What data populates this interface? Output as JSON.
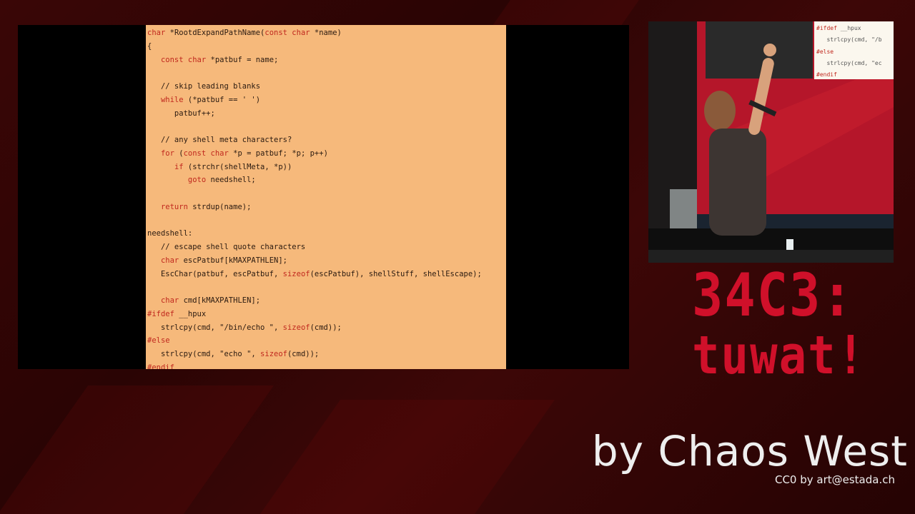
{
  "slide": {
    "code_lines": [
      [
        {
          "t": "char",
          "k": 1
        },
        {
          "t": " *RootdExpandPathName("
        },
        {
          "t": "const char",
          "k": 1
        },
        {
          "t": " *name)"
        }
      ],
      [
        {
          "t": "{"
        }
      ],
      [
        {
          "t": "   "
        },
        {
          "t": "const char",
          "k": 1
        },
        {
          "t": " *patbuf = name;"
        }
      ],
      [
        {
          "t": ""
        }
      ],
      [
        {
          "t": "   // skip leading blanks"
        }
      ],
      [
        {
          "t": "   "
        },
        {
          "t": "while",
          "k": 1
        },
        {
          "t": " (*patbuf == ' ')"
        }
      ],
      [
        {
          "t": "      patbuf++;"
        }
      ],
      [
        {
          "t": ""
        }
      ],
      [
        {
          "t": "   // any shell meta characters?"
        }
      ],
      [
        {
          "t": "   "
        },
        {
          "t": "for",
          "k": 1
        },
        {
          "t": " ("
        },
        {
          "t": "const char",
          "k": 1
        },
        {
          "t": " *p = patbuf; *p; p++)"
        }
      ],
      [
        {
          "t": "      "
        },
        {
          "t": "if",
          "k": 1
        },
        {
          "t": " (strchr(shellMeta, *p))"
        }
      ],
      [
        {
          "t": "         "
        },
        {
          "t": "goto",
          "k": 1
        },
        {
          "t": " needshell;"
        }
      ],
      [
        {
          "t": ""
        }
      ],
      [
        {
          "t": "   "
        },
        {
          "t": "return",
          "k": 1
        },
        {
          "t": " strdup(name);"
        }
      ],
      [
        {
          "t": ""
        }
      ],
      [
        {
          "t": "needshell:"
        }
      ],
      [
        {
          "t": "   // escape shell quote characters"
        }
      ],
      [
        {
          "t": "   "
        },
        {
          "t": "char",
          "k": 1
        },
        {
          "t": " escPatbuf[kMAXPATHLEN];"
        }
      ],
      [
        {
          "t": "   EscChar(patbuf, escPatbuf, "
        },
        {
          "t": "sizeof",
          "k": 1
        },
        {
          "t": "(escPatbuf), shellStuff, shellEscape);"
        }
      ],
      [
        {
          "t": ""
        }
      ],
      [
        {
          "t": "   "
        },
        {
          "t": "char",
          "k": 1
        },
        {
          "t": " cmd[kMAXPATHLEN];"
        }
      ],
      [
        {
          "t": "#ifdef",
          "k": 1
        },
        {
          "t": " __hpux"
        }
      ],
      [
        {
          "t": "   strlcpy(cmd, \"/bin/echo \", "
        },
        {
          "t": "sizeof",
          "k": 1
        },
        {
          "t": "(cmd));"
        }
      ],
      [
        {
          "t": "#else",
          "k": 1
        }
      ],
      [
        {
          "t": "   strlcpy(cmd, \"echo \", "
        },
        {
          "t": "sizeof",
          "k": 1
        },
        {
          "t": "(cmd));"
        }
      ],
      [
        {
          "t": "#endif",
          "k": 1
        }
      ]
    ]
  },
  "inset": {
    "lines": [
      [
        {
          "t": "#ifdef",
          "k": 1
        },
        {
          "t": " __hpux"
        }
      ],
      [
        {
          "t": "   strlcpy(cmd, \"/b"
        }
      ],
      [
        {
          "t": "#else",
          "k": 1
        }
      ],
      [
        {
          "t": "   strlcpy(cmd, \"ec"
        }
      ],
      [
        {
          "t": "#endif",
          "k": 1
        }
      ]
    ]
  },
  "logo": {
    "line1": "34C3:",
    "line2": "tuwat!"
  },
  "credit": {
    "main": "by Chaos West",
    "license": "CC0 by art@estada.ch"
  },
  "colors": {
    "keyword": "#c0281e",
    "code_bg": "#f6b97b",
    "logo_red": "#d0102a"
  }
}
